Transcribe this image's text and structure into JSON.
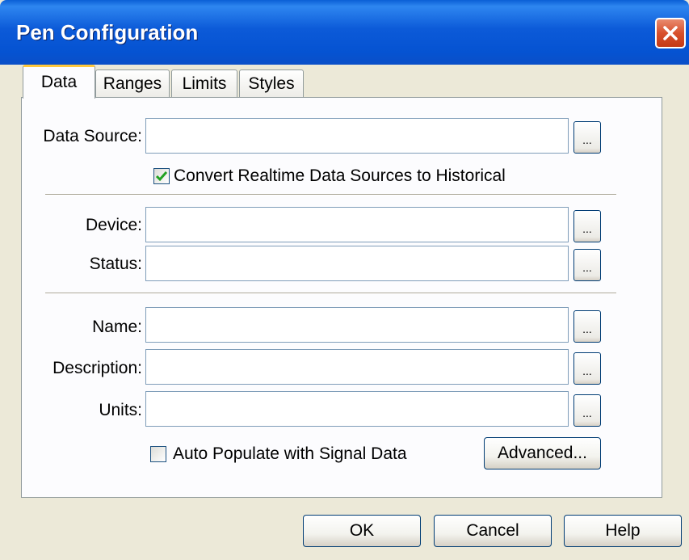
{
  "window": {
    "title": "Pen Configuration"
  },
  "tabs": [
    {
      "label": "Data",
      "active": true
    },
    {
      "label": "Ranges",
      "active": false
    },
    {
      "label": "Limits",
      "active": false
    },
    {
      "label": "Styles",
      "active": false
    }
  ],
  "fields": {
    "data_source": {
      "label": "Data Source:",
      "value": ""
    },
    "device": {
      "label": "Device:",
      "value": ""
    },
    "status": {
      "label": "Status:",
      "value": ""
    },
    "name": {
      "label": "Name:",
      "value": ""
    },
    "description": {
      "label": "Description:",
      "value": ""
    },
    "units": {
      "label": "Units:",
      "value": ""
    }
  },
  "browse_label": "...",
  "convert_checkbox": {
    "label": "Convert Realtime Data Sources to Historical",
    "checked": true
  },
  "auto_populate_checkbox": {
    "label": "Auto Populate with Signal Data",
    "checked": false
  },
  "buttons": {
    "advanced": "Advanced...",
    "ok": "OK",
    "cancel": "Cancel",
    "help": "Help"
  },
  "colors": {
    "titlebar": "#0553d2",
    "tab_highlight": "#ffc83c",
    "check": "#21a121"
  }
}
